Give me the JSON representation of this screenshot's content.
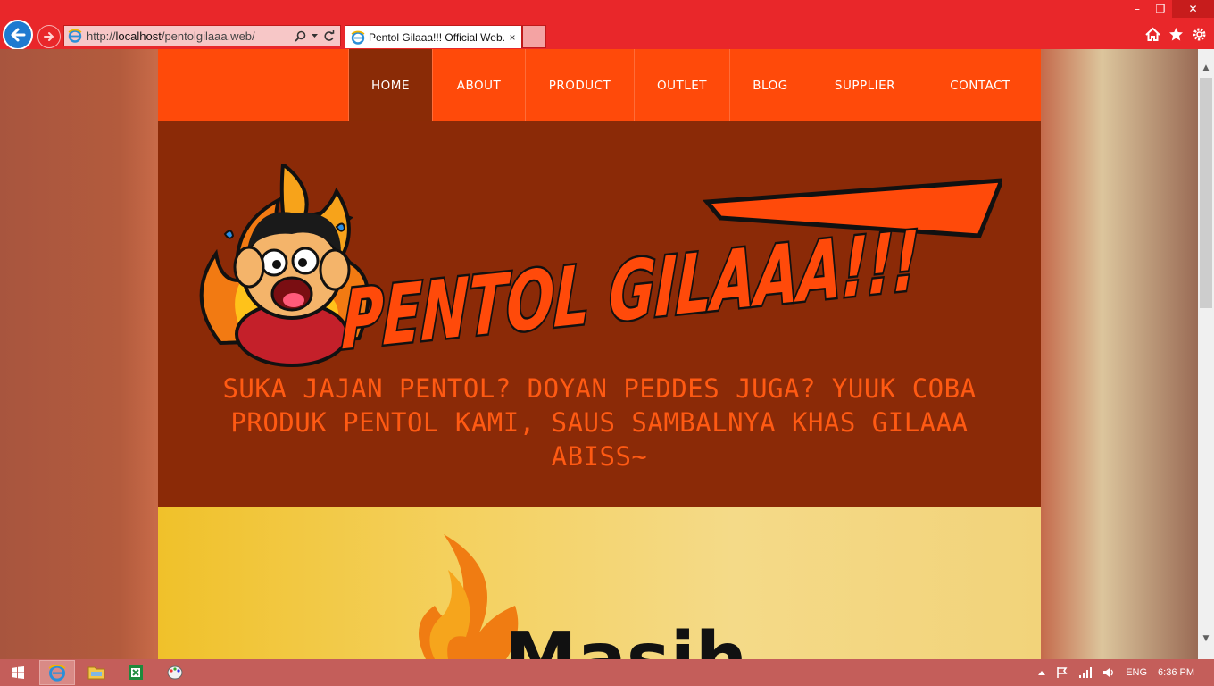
{
  "browser": {
    "address_url_prefix": "http://",
    "address_url_host": "localhost",
    "address_url_path": "/pentolgilaaa.web/",
    "tab_title": "Pentol Gilaaa!!! Official Web...",
    "tab_close": "×",
    "minimize": "–",
    "restore": "❐",
    "close": "✕"
  },
  "nav": {
    "items": [
      {
        "label": "HOME",
        "active": true
      },
      {
        "label": "ABOUT"
      },
      {
        "label": "PRODUCT"
      },
      {
        "label": "OUTLET"
      },
      {
        "label": "BLOG"
      },
      {
        "label": "SUPPLIER"
      },
      {
        "label": "CONTACT"
      }
    ]
  },
  "hero": {
    "logo_text": "PENTOL GILAAA!!!",
    "tagline": "SUKA JAJAN PENTOL? DOYAN PEDDES JUGA? YUUK COBA PRODUK PENTOL KAMI, SAUS SAMBALNYA KHAS GILAAA ABISS~"
  },
  "banner": {
    "text": "Masih"
  },
  "taskbar": {
    "lang": "ENG",
    "time": "6:36 PM"
  },
  "colors": {
    "chrome": "#e9272a",
    "nav": "#ff4a0a",
    "nav_active": "#8a2b06",
    "hero": "#8b2a07",
    "tagline": "#ff5a13"
  }
}
